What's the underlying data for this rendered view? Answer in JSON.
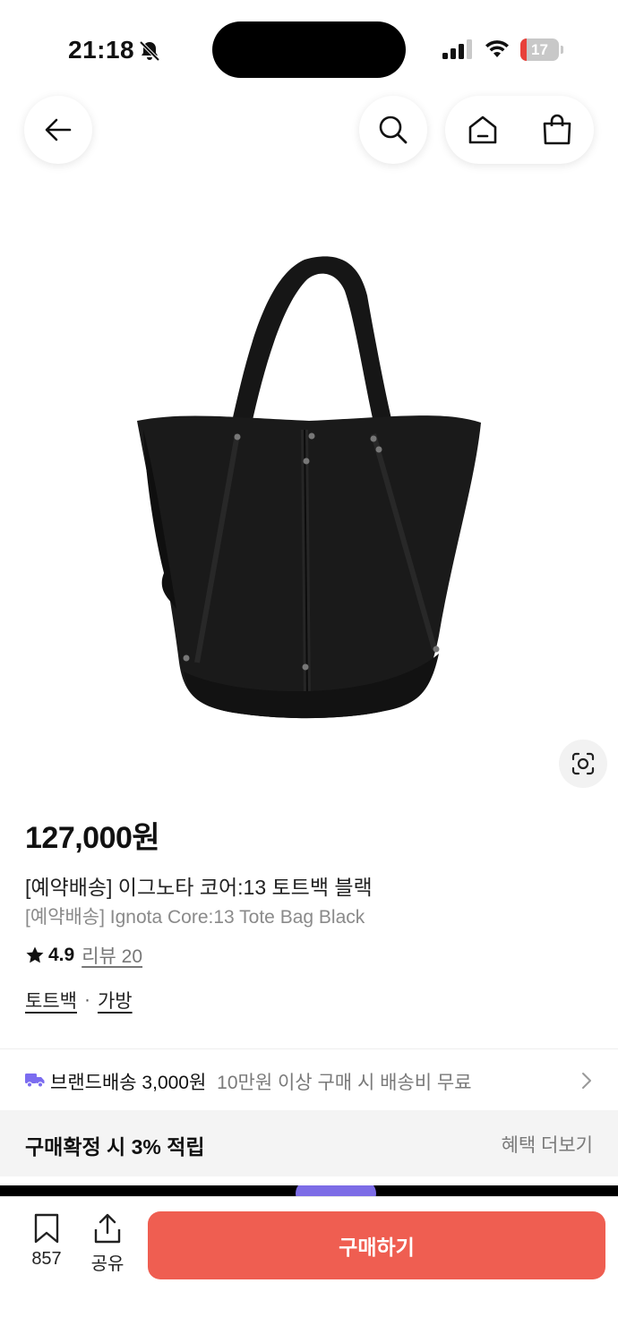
{
  "status_bar": {
    "time": "21:18",
    "battery_level": "17",
    "battery_fraction": 0.17,
    "icons": [
      "bell-slash-icon",
      "cellular-signal-icon",
      "wifi-icon",
      "battery-icon"
    ]
  },
  "nav": {
    "icons": [
      "arrow-left-icon",
      "search-icon",
      "home-icon",
      "shopping-bag-icon"
    ]
  },
  "product": {
    "image_icon": "black-tote-bag-image",
    "price": "127,000원",
    "name": "[예약배송] 이그노타 코어:13 토트백 블랙",
    "name_en": "[예약배송] Ignota Core:13 Tote Bag Black",
    "rating": "4.9",
    "review_link": "리뷰 20",
    "categories": [
      "토트백",
      "가방"
    ],
    "category_separator": "·"
  },
  "shipping": {
    "label": "브랜드배송 3,000원",
    "sub": "10만원 이상 구매 시 배송비 무료"
  },
  "benefit": {
    "text": "구매확정 시 3% 적립",
    "link": "혜택 더보기"
  },
  "bottom_bar": {
    "bookmark_count": "857",
    "share_label": "공유",
    "buy_label": "구매하기"
  },
  "colors": {
    "buy_button": "#ef5e51",
    "truck_icon": "#7b6cf0",
    "battery_low": "#e8413a",
    "benefit_bg": "#f4f4f4"
  }
}
